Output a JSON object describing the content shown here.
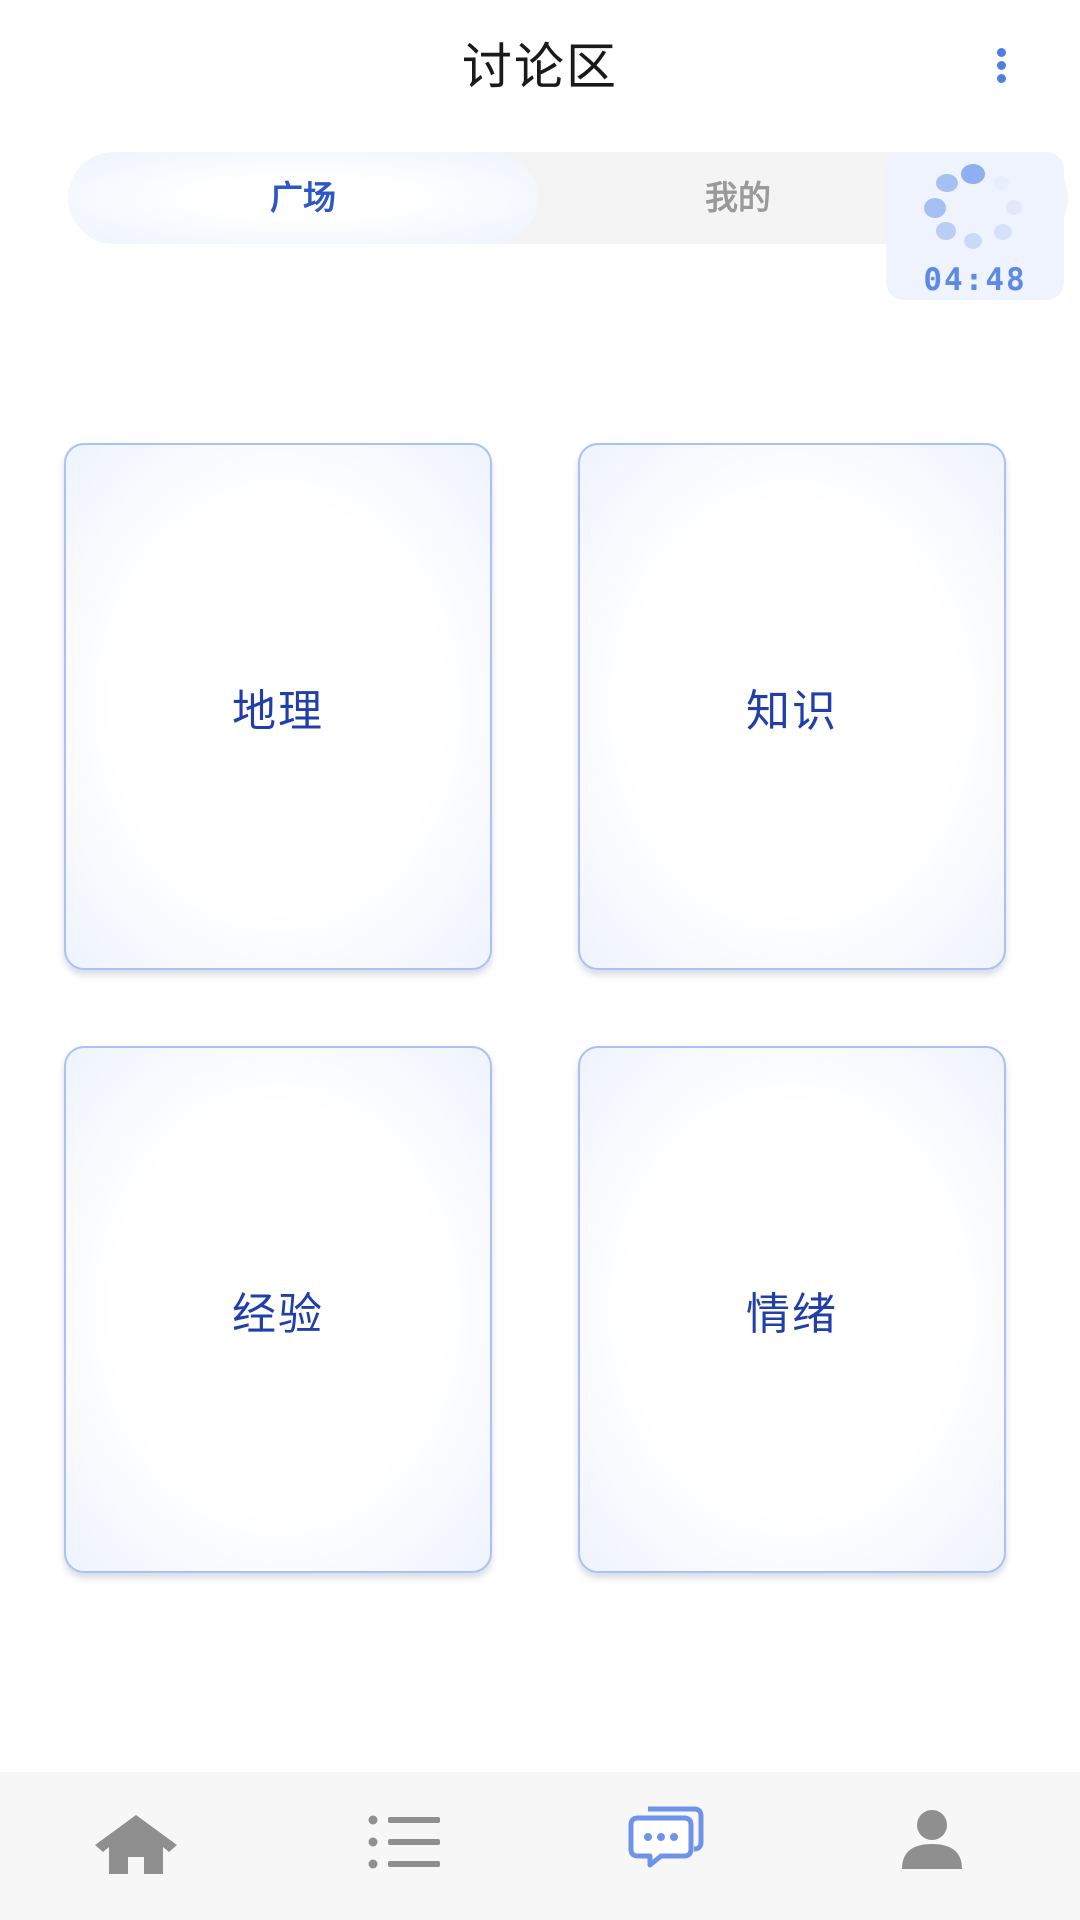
{
  "header": {
    "title": "讨论区"
  },
  "tabs": [
    {
      "label": "广场",
      "active": true
    },
    {
      "label": "我的",
      "active": false
    }
  ],
  "timer": {
    "time": "04:48",
    "icon": "loading-spinner-icon"
  },
  "cards": [
    {
      "label": "地理"
    },
    {
      "label": "知识"
    },
    {
      "label": "经验"
    },
    {
      "label": "情绪"
    }
  ],
  "bottom_nav": [
    {
      "icon": "home-icon",
      "active": false
    },
    {
      "icon": "list-icon",
      "active": false
    },
    {
      "icon": "chat-icon",
      "active": true
    },
    {
      "icon": "profile-icon",
      "active": false
    }
  ],
  "colors": {
    "accent": "#4f7fe0",
    "card_text": "#213fa8",
    "inactive_icon": "#8f8f8f",
    "active_icon": "#6d94e8"
  }
}
